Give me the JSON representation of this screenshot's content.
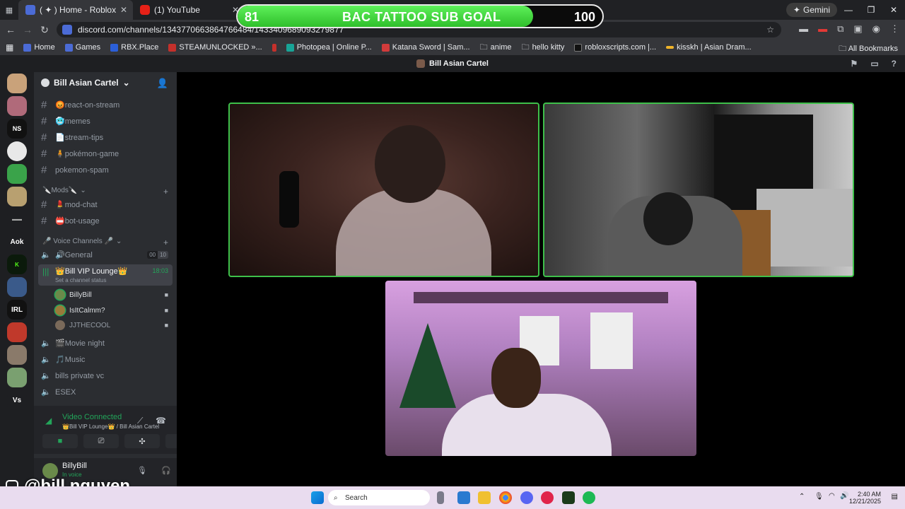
{
  "tabs": [
    {
      "label": "( ✦ ) Home - Roblox"
    },
    {
      "label": "(1) YouTube"
    }
  ],
  "gemini_label": "Gemini",
  "url": "discord.com/channels/1343770663864766484/1433409689093279877",
  "bookmarks": [
    "Home",
    "Games",
    "RBX.Place",
    "STEAMUNLOCKED »...",
    "Photopea | Online P...",
    "Katana Sword | Sam...",
    "anime",
    "hello kitty",
    "robloxscripts.com |...",
    "kisskh | Asian Dram..."
  ],
  "all_bookmarks": "All Bookmarks",
  "goal": {
    "current": "81",
    "title": "BAC TATTOO SUB GOAL",
    "max": "100",
    "progress": 0.81
  },
  "window_title": "Bill Asian Cartel",
  "server": {
    "name": "Bill Asian Cartel"
  },
  "server_labels": {
    "ns": "NS",
    "aok": "Aok",
    "irl": "IRL",
    "vs": "Vs"
  },
  "channels": [
    {
      "label": "😡react-on-stream"
    },
    {
      "label": "🥶memes"
    },
    {
      "label": "📄stream-tips"
    },
    {
      "label": "🧍pokémon-game"
    },
    {
      "label": "pokemon-spam"
    }
  ],
  "mods_category": "🔪Mods🔪",
  "mod_channels": [
    {
      "label": "💄mod-chat"
    },
    {
      "label": "📛bot-usage"
    }
  ],
  "voice_category": "🎤 Voice Channels 🎤",
  "voice_general": {
    "label": "🔊General",
    "count_a": "00",
    "count_b": "10"
  },
  "active_vc": {
    "label": "👑Bill VIP Lounge👑",
    "time": "18:03",
    "status": "Set a channel status"
  },
  "voice_users": [
    {
      "name": "BillyBill"
    },
    {
      "name": "IsItCalmm?"
    },
    {
      "name": "JJTHECOOL"
    }
  ],
  "other_voice": [
    {
      "label": "🎬Movie night"
    },
    {
      "label": "🎵Music"
    },
    {
      "label": "bills private vc"
    },
    {
      "label": "ESEX"
    }
  ],
  "connection": {
    "status": "Video Connected",
    "location": "👑Bill VIP Lounge👑 / Bill Asian Cartel"
  },
  "user": {
    "name": "BillyBill",
    "sub": "In voice"
  },
  "handle": "@bill.nguyen",
  "taskbar": {
    "search": "Search",
    "time": "2:40 AM",
    "date": "12/21/2025"
  },
  "colors": {
    "speaking": "#3ec04a",
    "goal_fill": "#3fd83a",
    "discord_bg": "#2b2d31"
  }
}
